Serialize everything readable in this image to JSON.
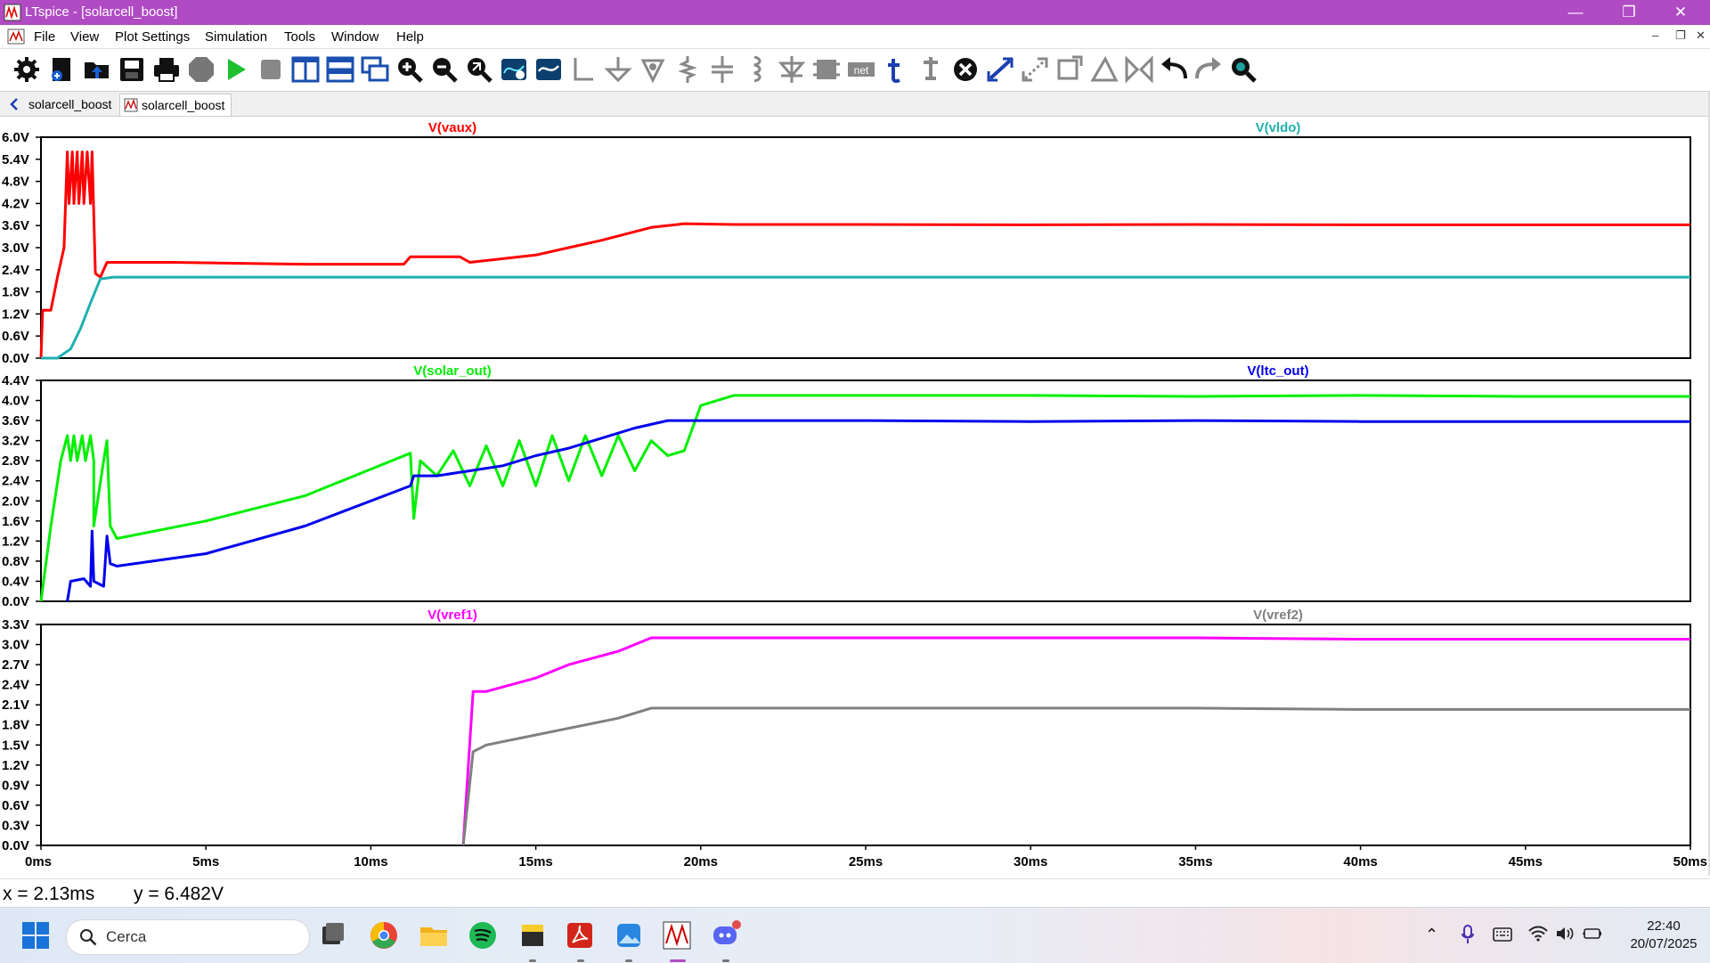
{
  "window": {
    "title": "LTspice - [solarcell_boost]"
  },
  "menu": [
    "File",
    "View",
    "Plot Settings",
    "Simulation",
    "Tools",
    "Window",
    "Help"
  ],
  "toolbar_icons": [
    "settings-icon",
    "new-schematic-icon",
    "open-icon",
    "save-icon",
    "print-icon",
    "halt-icon",
    "run-icon",
    "stop-icon",
    "tile-vertical-icon",
    "tile-horizontal-icon",
    "cascade-icon",
    "zoom-in-icon",
    "zoom-out-icon",
    "zoom-fit-icon",
    "autorange-icon",
    "add-trace-icon",
    "wire-icon",
    "ground-icon",
    "component-icon",
    "resistor-icon",
    "capacitor-icon",
    "inductor-icon",
    "diode-icon",
    "component-place-icon",
    "net-label-icon",
    "text-icon",
    "spice-directive-icon",
    "delete-icon",
    "move-icon",
    "drag-icon",
    "rotate-icon",
    "mirror-icon",
    "draw-icon",
    "mirror-h-icon",
    "undo-icon",
    "redo-icon",
    "find-icon"
  ],
  "tabs": [
    {
      "label": "solarcell_boost",
      "icon": "schematic-icon",
      "active": false
    },
    {
      "label": "solarcell_boost",
      "icon": "waveform-icon",
      "active": true
    }
  ],
  "status": {
    "x": "x = 2.13ms",
    "y": "y = 6.482V"
  },
  "taskbar": {
    "search_placeholder": "Cerca",
    "apps": [
      "windows-start-icon",
      "task-view-icon",
      "chrome-icon",
      "file-explorer-icon",
      "spotify-icon",
      "sticky-notes-icon",
      "acrobat-icon",
      "photos-icon",
      "ltspice-icon",
      "discord-icon"
    ],
    "time": "22:40",
    "date": "20/07/2025"
  },
  "chart_data": [
    {
      "type": "line",
      "title": "",
      "xlim": [
        0,
        50
      ],
      "ylim": [
        0,
        6
      ],
      "y_ticks": [
        "0.0V",
        "0.6V",
        "1.2V",
        "1.8V",
        "2.4V",
        "3.0V",
        "3.6V",
        "4.2V",
        "4.8V",
        "5.4V",
        "6.0V"
      ],
      "series": [
        {
          "name": "V(vaux)",
          "color": "#ff0000",
          "points": [
            [
              0,
              0
            ],
            [
              0.05,
              1.3
            ],
            [
              0.3,
              1.3
            ],
            [
              0.5,
              2.2
            ],
            [
              0.7,
              3.0
            ],
            [
              0.8,
              5.6
            ],
            [
              0.85,
              4.2
            ],
            [
              0.95,
              5.6
            ],
            [
              1.0,
              4.2
            ],
            [
              1.1,
              5.6
            ],
            [
              1.15,
              4.2
            ],
            [
              1.25,
              5.6
            ],
            [
              1.3,
              4.2
            ],
            [
              1.4,
              5.6
            ],
            [
              1.5,
              4.2
            ],
            [
              1.55,
              5.6
            ],
            [
              1.65,
              2.3
            ],
            [
              1.8,
              2.2
            ],
            [
              2.0,
              2.6
            ],
            [
              4,
              2.6
            ],
            [
              8,
              2.55
            ],
            [
              11,
              2.55
            ],
            [
              11.2,
              2.75
            ],
            [
              12.7,
              2.75
            ],
            [
              13.0,
              2.6
            ],
            [
              15,
              2.8
            ],
            [
              17,
              3.2
            ],
            [
              18.5,
              3.55
            ],
            [
              19.5,
              3.65
            ],
            [
              21,
              3.63
            ],
            [
              25,
              3.63
            ],
            [
              30,
              3.62
            ],
            [
              35,
              3.63
            ],
            [
              40,
              3.62
            ],
            [
              45,
              3.62
            ],
            [
              50,
              3.62
            ]
          ]
        },
        {
          "name": "V(vldo)",
          "color": "#1fb0b0",
          "points": [
            [
              0,
              0
            ],
            [
              0.5,
              0
            ],
            [
              0.9,
              0.25
            ],
            [
              1.2,
              0.8
            ],
            [
              1.5,
              1.5
            ],
            [
              1.8,
              2.15
            ],
            [
              2.2,
              2.2
            ],
            [
              10,
              2.2
            ],
            [
              20,
              2.2
            ],
            [
              30,
              2.2
            ],
            [
              40,
              2.2
            ],
            [
              50,
              2.2
            ]
          ]
        }
      ]
    },
    {
      "type": "line",
      "title": "",
      "xlim": [
        0,
        50
      ],
      "ylim": [
        0,
        4.4
      ],
      "y_ticks": [
        "0.0V",
        "0.4V",
        "0.8V",
        "1.2V",
        "1.6V",
        "2.0V",
        "2.4V",
        "2.8V",
        "3.2V",
        "3.6V",
        "4.0V",
        "4.4V"
      ],
      "series": [
        {
          "name": "V(solar_out)",
          "color": "#00ee00",
          "points": [
            [
              0,
              0
            ],
            [
              0.3,
              1.5
            ],
            [
              0.6,
              2.8
            ],
            [
              0.8,
              3.3
            ],
            [
              0.9,
              2.8
            ],
            [
              1.0,
              3.3
            ],
            [
              1.1,
              2.8
            ],
            [
              1.25,
              3.3
            ],
            [
              1.35,
              2.8
            ],
            [
              1.5,
              3.3
            ],
            [
              1.6,
              2.8
            ],
            [
              1.6,
              1.5
            ],
            [
              1.9,
              2.8
            ],
            [
              2.0,
              3.2
            ],
            [
              2.1,
              1.5
            ],
            [
              2.3,
              1.25
            ],
            [
              5,
              1.6
            ],
            [
              8,
              2.1
            ],
            [
              11.2,
              2.95
            ],
            [
              11.3,
              1.65
            ],
            [
              11.5,
              2.8
            ],
            [
              12,
              2.5
            ],
            [
              12.5,
              3.0
            ],
            [
              13,
              2.3
            ],
            [
              13.5,
              3.1
            ],
            [
              14,
              2.3
            ],
            [
              14.5,
              3.2
            ],
            [
              15,
              2.3
            ],
            [
              15.5,
              3.3
            ],
            [
              16,
              2.4
            ],
            [
              16.5,
              3.3
            ],
            [
              17,
              2.5
            ],
            [
              17.5,
              3.3
            ],
            [
              18,
              2.6
            ],
            [
              18.5,
              3.2
            ],
            [
              19,
              2.9
            ],
            [
              19.5,
              3.0
            ],
            [
              20,
              3.9
            ],
            [
              21,
              4.1
            ],
            [
              25,
              4.1
            ],
            [
              30,
              4.1
            ],
            [
              35,
              4.08
            ],
            [
              40,
              4.1
            ],
            [
              45,
              4.08
            ],
            [
              50,
              4.08
            ]
          ]
        },
        {
          "name": "V(ltc_out)",
          "color": "#0000ee",
          "points": [
            [
              0.8,
              0
            ],
            [
              0.9,
              0.4
            ],
            [
              1.3,
              0.45
            ],
            [
              1.5,
              0.3
            ],
            [
              1.55,
              1.4
            ],
            [
              1.6,
              0.4
            ],
            [
              1.9,
              0.3
            ],
            [
              2.0,
              1.3
            ],
            [
              2.1,
              0.75
            ],
            [
              2.3,
              0.7
            ],
            [
              5,
              0.95
            ],
            [
              8,
              1.5
            ],
            [
              11.2,
              2.3
            ],
            [
              11.3,
              2.5
            ],
            [
              12,
              2.5
            ],
            [
              13,
              2.6
            ],
            [
              14,
              2.7
            ],
            [
              15,
              2.9
            ],
            [
              16,
              3.05
            ],
            [
              17,
              3.25
            ],
            [
              18,
              3.45
            ],
            [
              19,
              3.6
            ],
            [
              20,
              3.6
            ],
            [
              25,
              3.6
            ],
            [
              30,
              3.58
            ],
            [
              35,
              3.6
            ],
            [
              40,
              3.58
            ],
            [
              45,
              3.58
            ],
            [
              50,
              3.58
            ]
          ]
        }
      ]
    },
    {
      "type": "line",
      "title": "",
      "xlim": [
        0,
        50
      ],
      "ylim": [
        0,
        3.3
      ],
      "x_ticks": [
        "0ms",
        "5ms",
        "10ms",
        "15ms",
        "20ms",
        "25ms",
        "30ms",
        "35ms",
        "40ms",
        "45ms",
        "50ms"
      ],
      "y_ticks": [
        "0.0V",
        "0.3V",
        "0.6V",
        "0.9V",
        "1.2V",
        "1.5V",
        "1.8V",
        "2.1V",
        "2.4V",
        "2.7V",
        "3.0V",
        "3.3V"
      ],
      "series": [
        {
          "name": "V(vref1)",
          "color": "#ff00ff",
          "points": [
            [
              12.8,
              0
            ],
            [
              13.1,
              2.3
            ],
            [
              13.5,
              2.3
            ],
            [
              15,
              2.5
            ],
            [
              16,
              2.7
            ],
            [
              17.5,
              2.9
            ],
            [
              18.5,
              3.1
            ],
            [
              20,
              3.1
            ],
            [
              25,
              3.1
            ],
            [
              30,
              3.1
            ],
            [
              35,
              3.1
            ],
            [
              40,
              3.08
            ],
            [
              45,
              3.08
            ],
            [
              50,
              3.08
            ]
          ]
        },
        {
          "name": "V(vref2)",
          "color": "#808080",
          "points": [
            [
              12.8,
              0
            ],
            [
              13.1,
              1.4
            ],
            [
              13.5,
              1.5
            ],
            [
              15,
              1.65
            ],
            [
              16,
              1.75
            ],
            [
              17.5,
              1.9
            ],
            [
              18.5,
              2.05
            ],
            [
              20,
              2.05
            ],
            [
              25,
              2.05
            ],
            [
              30,
              2.05
            ],
            [
              35,
              2.05
            ],
            [
              40,
              2.03
            ],
            [
              45,
              2.03
            ],
            [
              50,
              2.03
            ]
          ]
        }
      ]
    }
  ]
}
